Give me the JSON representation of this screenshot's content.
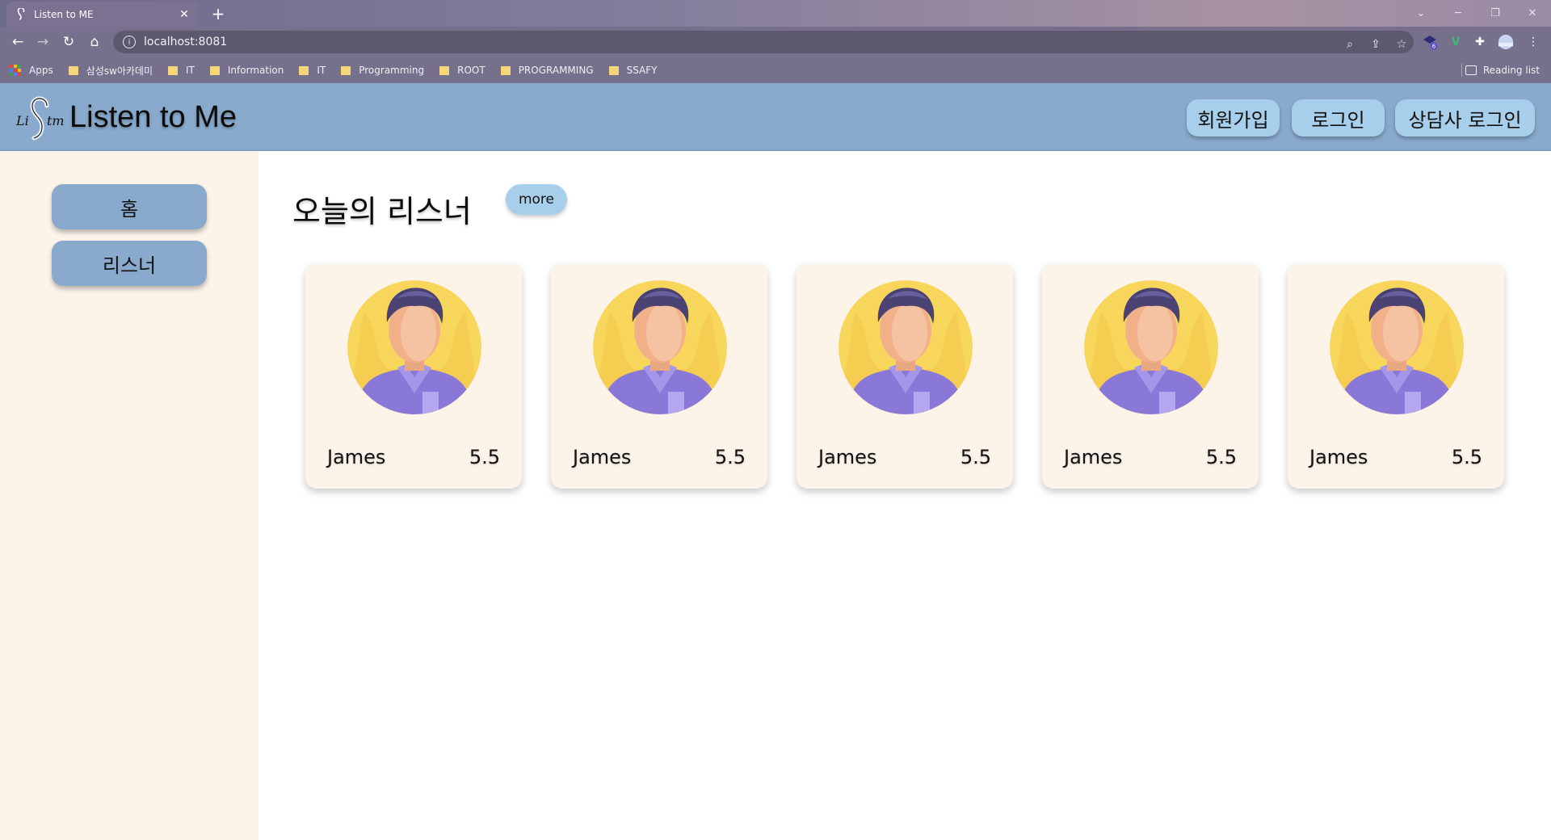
{
  "browser": {
    "tab_title": "Listen to ME",
    "url": "localhost:8081",
    "extension_badge": "6",
    "bookmarks": [
      {
        "label": "Apps",
        "type": "apps"
      },
      {
        "label": "삼성sw아카데미",
        "type": "folder"
      },
      {
        "label": "IT",
        "type": "folder"
      },
      {
        "label": "Information",
        "type": "folder"
      },
      {
        "label": "IT",
        "type": "folder"
      },
      {
        "label": "Programming",
        "type": "folder"
      },
      {
        "label": "ROOT",
        "type": "folder"
      },
      {
        "label": "PROGRAMMING",
        "type": "folder"
      },
      {
        "label": "SSAFY",
        "type": "folder"
      }
    ],
    "reading_list": "Reading list"
  },
  "header": {
    "logo_text": "Listen to Me",
    "buttons": {
      "signup": "회원가입",
      "login": "로그인",
      "counselor_login": "상담사 로그인"
    }
  },
  "sidebar": {
    "items": [
      {
        "label": "홈"
      },
      {
        "label": "리스너"
      }
    ]
  },
  "main": {
    "section_title": "오늘의 리스너",
    "more_label": "more",
    "listeners": [
      {
        "name": "James",
        "rating": "5.5"
      },
      {
        "name": "James",
        "rating": "5.5"
      },
      {
        "name": "James",
        "rating": "5.5"
      },
      {
        "name": "James",
        "rating": "5.5"
      },
      {
        "name": "James",
        "rating": "5.5"
      }
    ]
  },
  "colors": {
    "header_bg": "#89aacd",
    "sidebar_bg": "#fcf3e9",
    "button_light": "#a7ceeb",
    "card_bg": "#fcf3e9"
  }
}
